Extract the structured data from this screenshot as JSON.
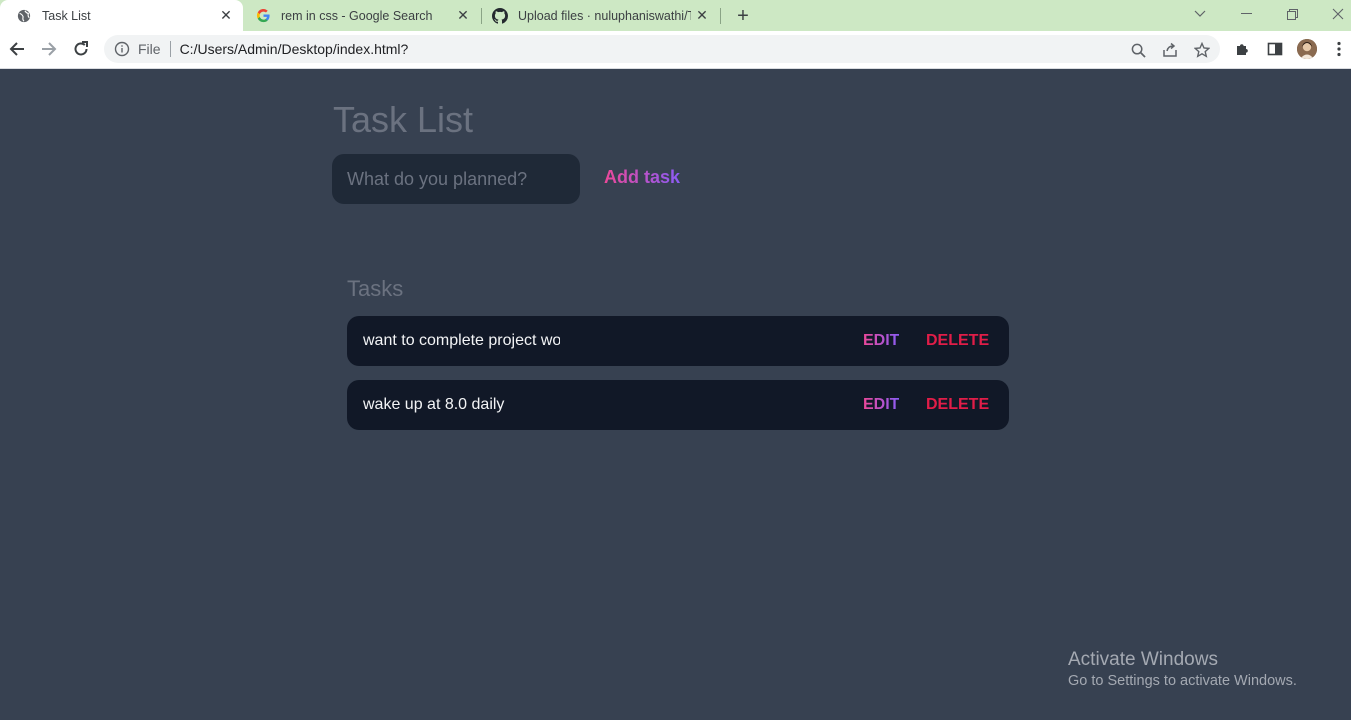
{
  "browser": {
    "tabs": [
      {
        "title": "Task List",
        "icon": "globe-icon",
        "active": true
      },
      {
        "title": "rem in css - Google Search",
        "icon": "google-icon",
        "active": false
      },
      {
        "title": "Upload files · nuluphaniswathi/To",
        "icon": "github-icon",
        "active": false
      }
    ],
    "new_tab": "+",
    "address": {
      "security_label": "File",
      "url": "C:/Users/Admin/Desktop/index.html?"
    }
  },
  "app": {
    "title": "Task List",
    "input": {
      "placeholder": "What do you planned?",
      "value": ""
    },
    "add_label": "Add task",
    "tasks_heading": "Tasks",
    "tasks": [
      {
        "text": "want to complete project work",
        "edit_label": "EDIT",
        "delete_label": "DELETE"
      },
      {
        "text": "wake up at 8.0 daily",
        "edit_label": "EDIT",
        "delete_label": "DELETE"
      }
    ]
  },
  "watermark": {
    "line1": "Activate Windows",
    "line2": "Go to Settings to activate Windows."
  },
  "colors": {
    "page_bg": "#374151",
    "card_bg": "#111827",
    "input_bg": "#1f2937",
    "accent_gradient_start": "#ec4899",
    "accent_gradient_end": "#8b5cf6",
    "delete": "#e11d48",
    "tabbar_bg": "#cde8c4"
  }
}
